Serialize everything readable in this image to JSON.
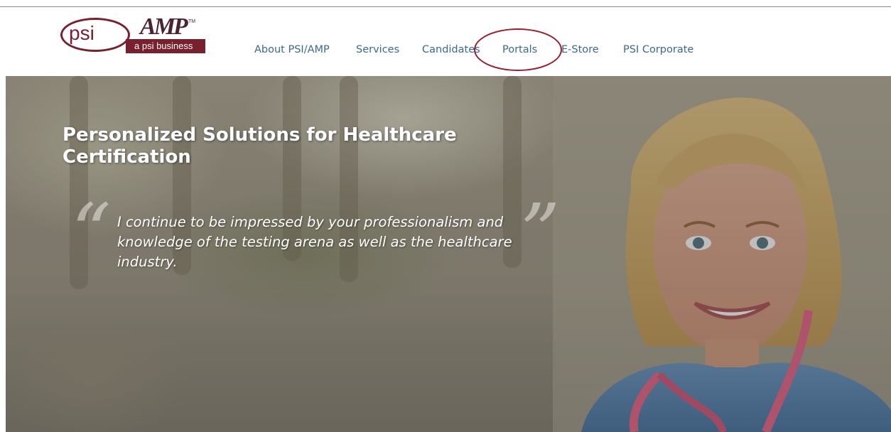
{
  "brand": {
    "logo_psi": "psi",
    "logo_amp": "AMP",
    "logo_tm": "TM",
    "logo_tagline": "a psi business",
    "brand_color": "#7a1f2e"
  },
  "nav": {
    "items": [
      {
        "label": "About PSI/AMP"
      },
      {
        "label": "Services"
      },
      {
        "label": "Candidates"
      },
      {
        "label": "Portals"
      },
      {
        "label": "E-Store"
      },
      {
        "label": "PSI Corporate"
      }
    ],
    "link_color": "#3a6a8e",
    "highlighted_item": "Portals",
    "highlight_color": "#9a1f2e"
  },
  "hero": {
    "title": "Personalized Solutions for Healthcare Certification",
    "quote_open": "“",
    "quote_close": "”",
    "quote": "I continue to be impressed by your professionalism and knowledge of the testing arena as well as the healthcare industry."
  }
}
